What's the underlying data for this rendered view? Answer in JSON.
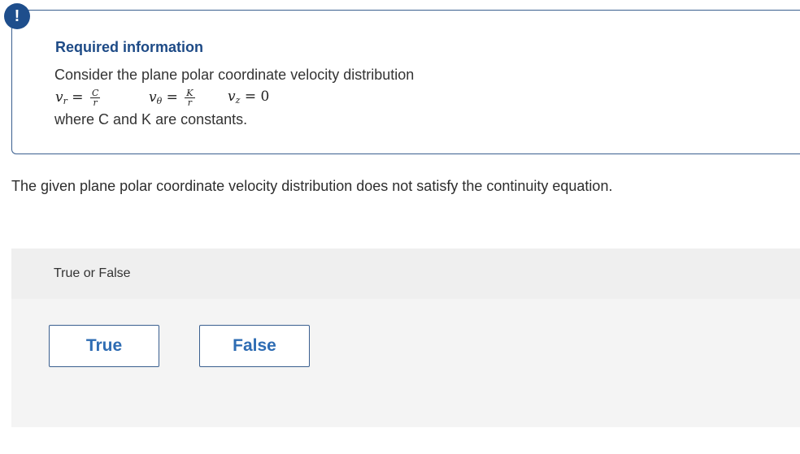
{
  "info": {
    "icon_symbol": "!",
    "icon_name": "alert-icon",
    "title": "Required information",
    "intro": "Consider the plane polar coordinate velocity distribution",
    "formula": {
      "vr_var": "v",
      "vr_sub": "r",
      "vr_num": "C",
      "vr_den": "r",
      "vtheta_var": "v",
      "vtheta_sub": "θ",
      "vtheta_num": "K",
      "vtheta_den": "r",
      "vz_var": "v",
      "vz_sub": "z",
      "vz_value": "0",
      "equals": "="
    },
    "footnote": "where C and K are constants."
  },
  "question": "The given plane polar coordinate velocity distribution does not satisfy the continuity equation.",
  "answer": {
    "label": "True or False",
    "options": [
      "True",
      "False"
    ]
  },
  "colors": {
    "accent": "#1e4e8c",
    "button_text": "#2e6cb3",
    "panel_bg": "#f4f4f4"
  }
}
